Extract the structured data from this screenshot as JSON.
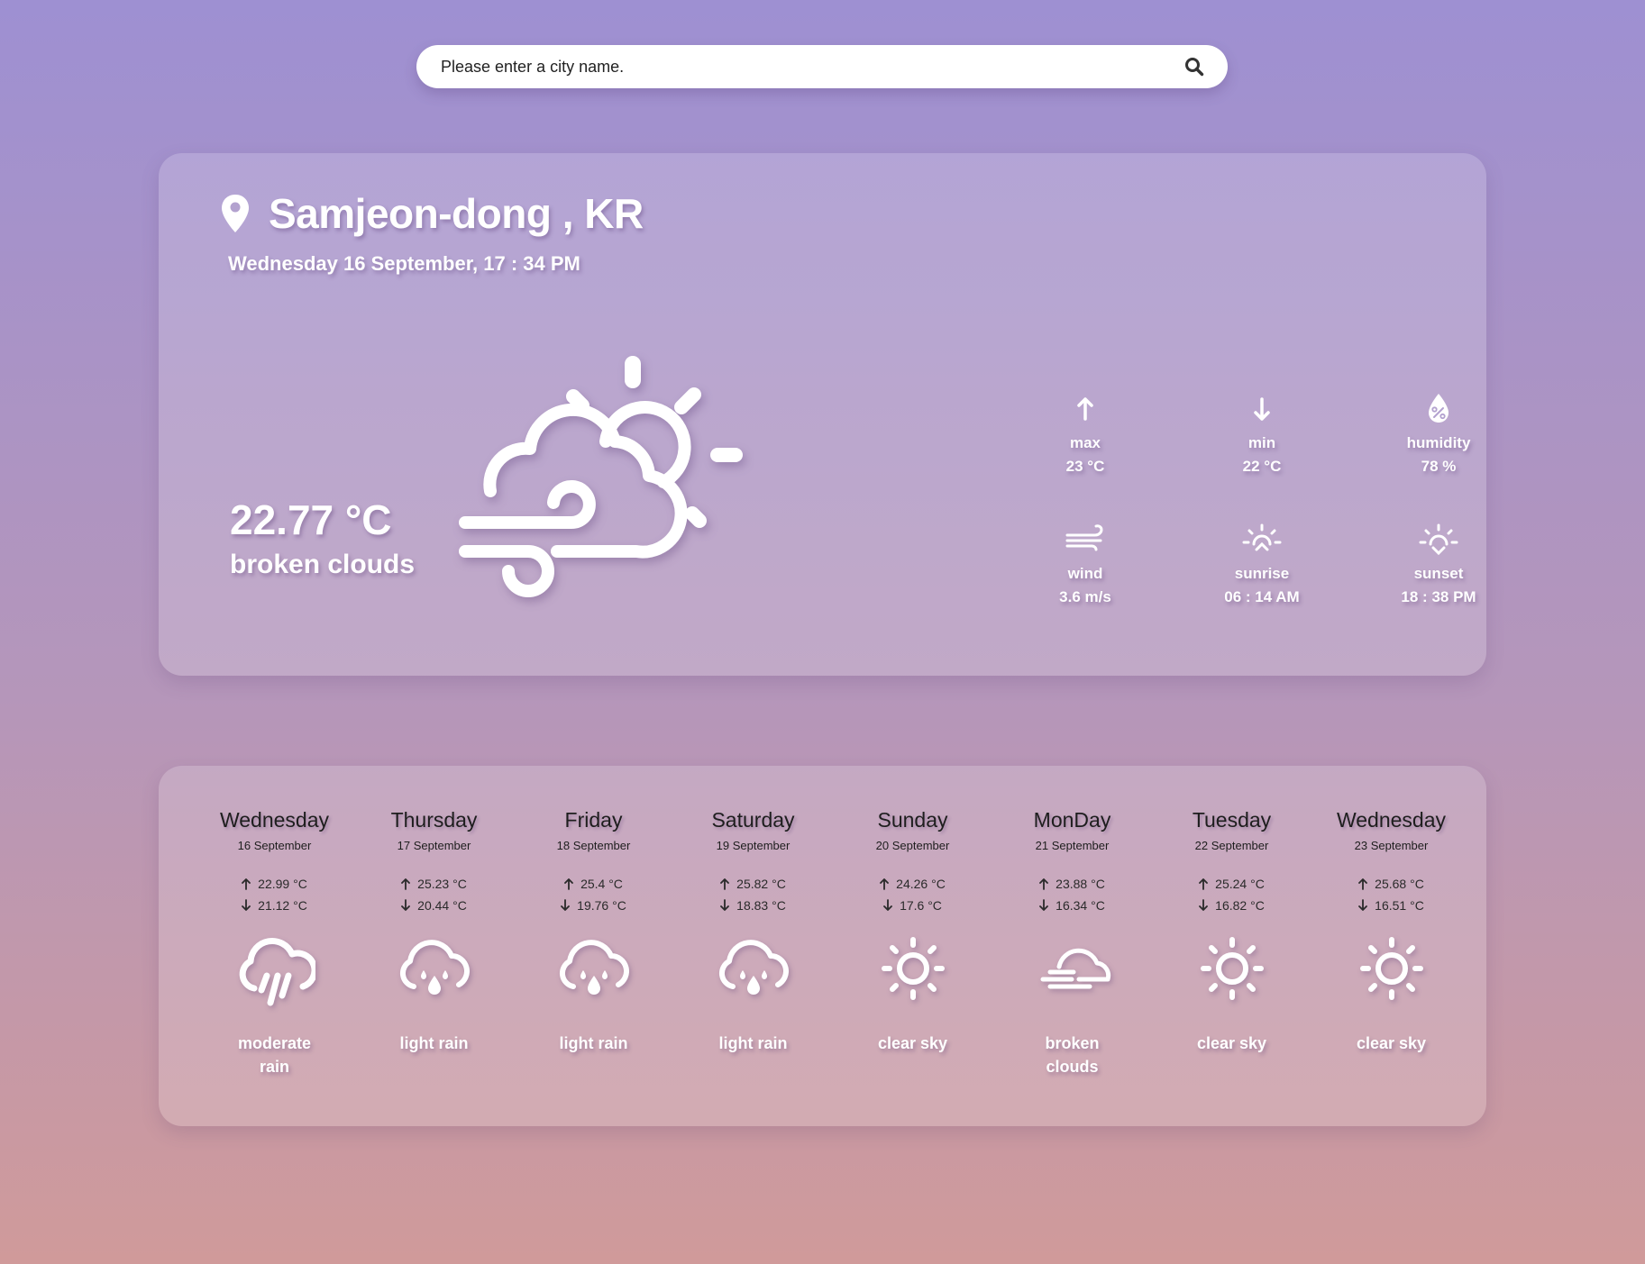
{
  "search": {
    "placeholder": "Please enter a city name."
  },
  "current": {
    "location": "Samjeon-dong , KR",
    "datetime": "Wednesday 16 September, 17 : 34 PM",
    "temperature": "22.77 °C",
    "description": "broken clouds",
    "icon": "wind-cloud-sun-icon",
    "stats": [
      {
        "icon": "arrow-up-icon",
        "label": "max",
        "value": "23 °C"
      },
      {
        "icon": "arrow-down-icon",
        "label": "min",
        "value": "22 °C"
      },
      {
        "icon": "humidity-drop-icon",
        "label": "humidity",
        "value": "78 %"
      },
      {
        "icon": "wind-icon",
        "label": "wind",
        "value": "3.6 m/s"
      },
      {
        "icon": "sunrise-icon",
        "label": "sunrise",
        "value": "06 : 14 AM"
      },
      {
        "icon": "sunset-icon",
        "label": "sunset",
        "value": "18 : 38 PM"
      }
    ]
  },
  "forecast": [
    {
      "day": "Wednesday",
      "date": "16 September",
      "max": "22.99 °C",
      "min": "21.12 °C",
      "icon": "heavy-rain-icon",
      "description": "moderate rain"
    },
    {
      "day": "Thursday",
      "date": "17 September",
      "max": "25.23 °C",
      "min": "20.44 °C",
      "icon": "light-rain-icon",
      "description": "light rain"
    },
    {
      "day": "Friday",
      "date": "18 September",
      "max": "25.4 °C",
      "min": "19.76 °C",
      "icon": "light-rain-icon",
      "description": "light rain"
    },
    {
      "day": "Saturday",
      "date": "19 September",
      "max": "25.82 °C",
      "min": "18.83 °C",
      "icon": "light-rain-icon",
      "description": "light rain"
    },
    {
      "day": "Sunday",
      "date": "20 September",
      "max": "24.26 °C",
      "min": "17.6 °C",
      "icon": "sun-icon",
      "description": "clear sky"
    },
    {
      "day": "MonDay",
      "date": "21 September",
      "max": "23.88 °C",
      "min": "16.34 °C",
      "icon": "cloud-fog-icon",
      "description": "broken clouds"
    },
    {
      "day": "Tuesday",
      "date": "22 September",
      "max": "25.24 °C",
      "min": "16.82 °C",
      "icon": "sun-icon",
      "description": "clear sky"
    },
    {
      "day": "Wednesday",
      "date": "23 September",
      "max": "25.68 °C",
      "min": "16.51 °C",
      "icon": "sun-icon",
      "description": "clear sky"
    }
  ]
}
